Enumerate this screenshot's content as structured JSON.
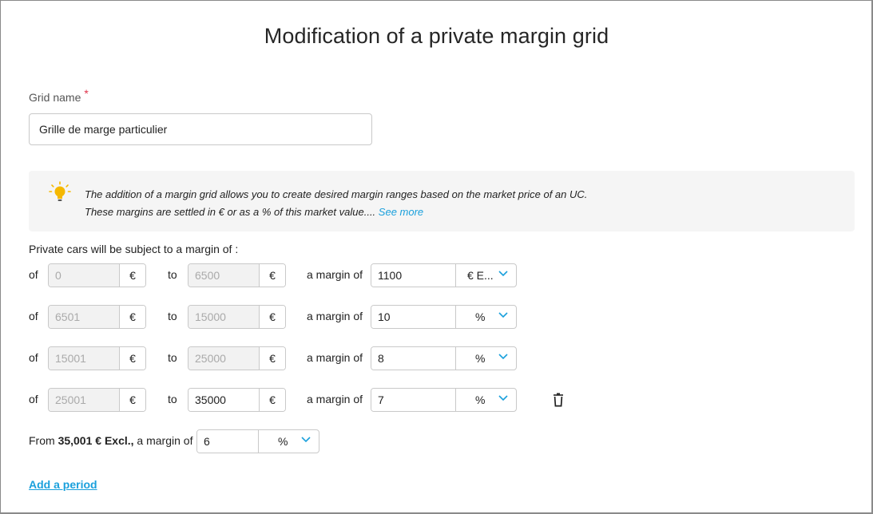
{
  "title": "Modification of a private margin grid",
  "grid_name": {
    "label": "Grid name",
    "required_mark": "*",
    "value": "Grille de marge particulier"
  },
  "info": {
    "line1": "The addition of a margin grid allows you to create desired margin ranges based on the market price of an UC.",
    "line2": "These margins are settled in € or as a % of this market value....",
    "see_more": "See more"
  },
  "subject_label": "Private cars will be subject to a margin of :",
  "labels": {
    "of": "of",
    "to": "to",
    "a_margin_of": "a margin of"
  },
  "rows": [
    {
      "from": "0",
      "from_unit": "€",
      "to": "6500",
      "to_unit": "€",
      "margin": "1100",
      "margin_unit": "€ E..."
    },
    {
      "from": "6501",
      "from_unit": "€",
      "to": "15000",
      "to_unit": "€",
      "margin": "10",
      "margin_unit": "%"
    },
    {
      "from": "15001",
      "from_unit": "€",
      "to": "25000",
      "to_unit": "€",
      "margin": "8",
      "margin_unit": "%"
    },
    {
      "from": "25001",
      "from_unit": "€",
      "to": "35000",
      "to_unit": "€",
      "margin": "7",
      "margin_unit": "%"
    }
  ],
  "final": {
    "prefix": "From",
    "amount": "35,001 € Excl.,",
    "suffix": "a margin of",
    "margin": "6",
    "margin_unit": "%"
  },
  "add_period": "Add a period",
  "colors": {
    "accent": "#1aa0dc",
    "required": "#e0344b",
    "bulb": "#f5b800"
  }
}
